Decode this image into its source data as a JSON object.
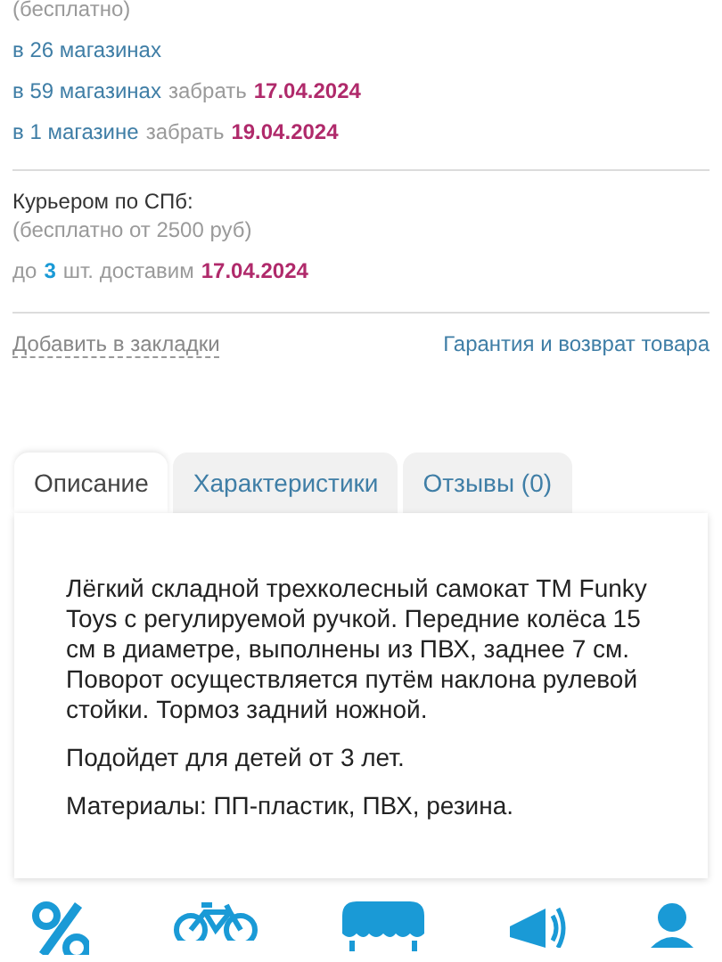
{
  "pickup": {
    "note": "(бесплатно)",
    "rows": [
      [
        {
          "kind": "link",
          "text": "в 26 магазинах"
        }
      ],
      [
        {
          "kind": "link",
          "text": "в 59 магазинах"
        },
        {
          "kind": "plain",
          "text": "забрать"
        },
        {
          "kind": "date",
          "text": "17.04.2024"
        }
      ],
      [
        {
          "kind": "link",
          "text": "в 1 магазине"
        },
        {
          "kind": "plain",
          "text": "забрать"
        },
        {
          "kind": "date",
          "text": "19.04.2024"
        }
      ]
    ]
  },
  "courier": {
    "title": "Курьером по СПб:",
    "note": "(бесплатно от 2500 руб)",
    "rows": [
      [
        {
          "kind": "plain",
          "text": "до"
        },
        {
          "kind": "count",
          "text": "3"
        },
        {
          "kind": "plain",
          "text": "шт. доставим"
        },
        {
          "kind": "date",
          "text": "17.04.2024"
        }
      ]
    ]
  },
  "links": {
    "bookmark": "Добавить в закладки",
    "warranty": "Гарантия и возврат товара"
  },
  "tabs": [
    {
      "label": "Описание",
      "selected": true
    },
    {
      "label": "Характеристики",
      "selected": false
    },
    {
      "label": "Отзывы (0)",
      "selected": false
    }
  ],
  "description": [
    "Лёгкий складной трехколесный самокат TM Funky Toys с регулируемой ручкой. Передние колёса 15 см в диаметре, выполнены из ПВХ, заднее 7 см. Поворот осуществляется путём наклона рулевой стойки. Тормоз задний ножной.",
    "Подойдет для детей от 3 лет.",
    "Материалы: ПП-пластик, ПВХ, резина."
  ],
  "features": [
    {
      "kind": "percent"
    },
    {
      "kind": "bike"
    },
    {
      "kind": "store"
    },
    {
      "kind": "megaphone"
    },
    {
      "kind": "person"
    }
  ]
}
